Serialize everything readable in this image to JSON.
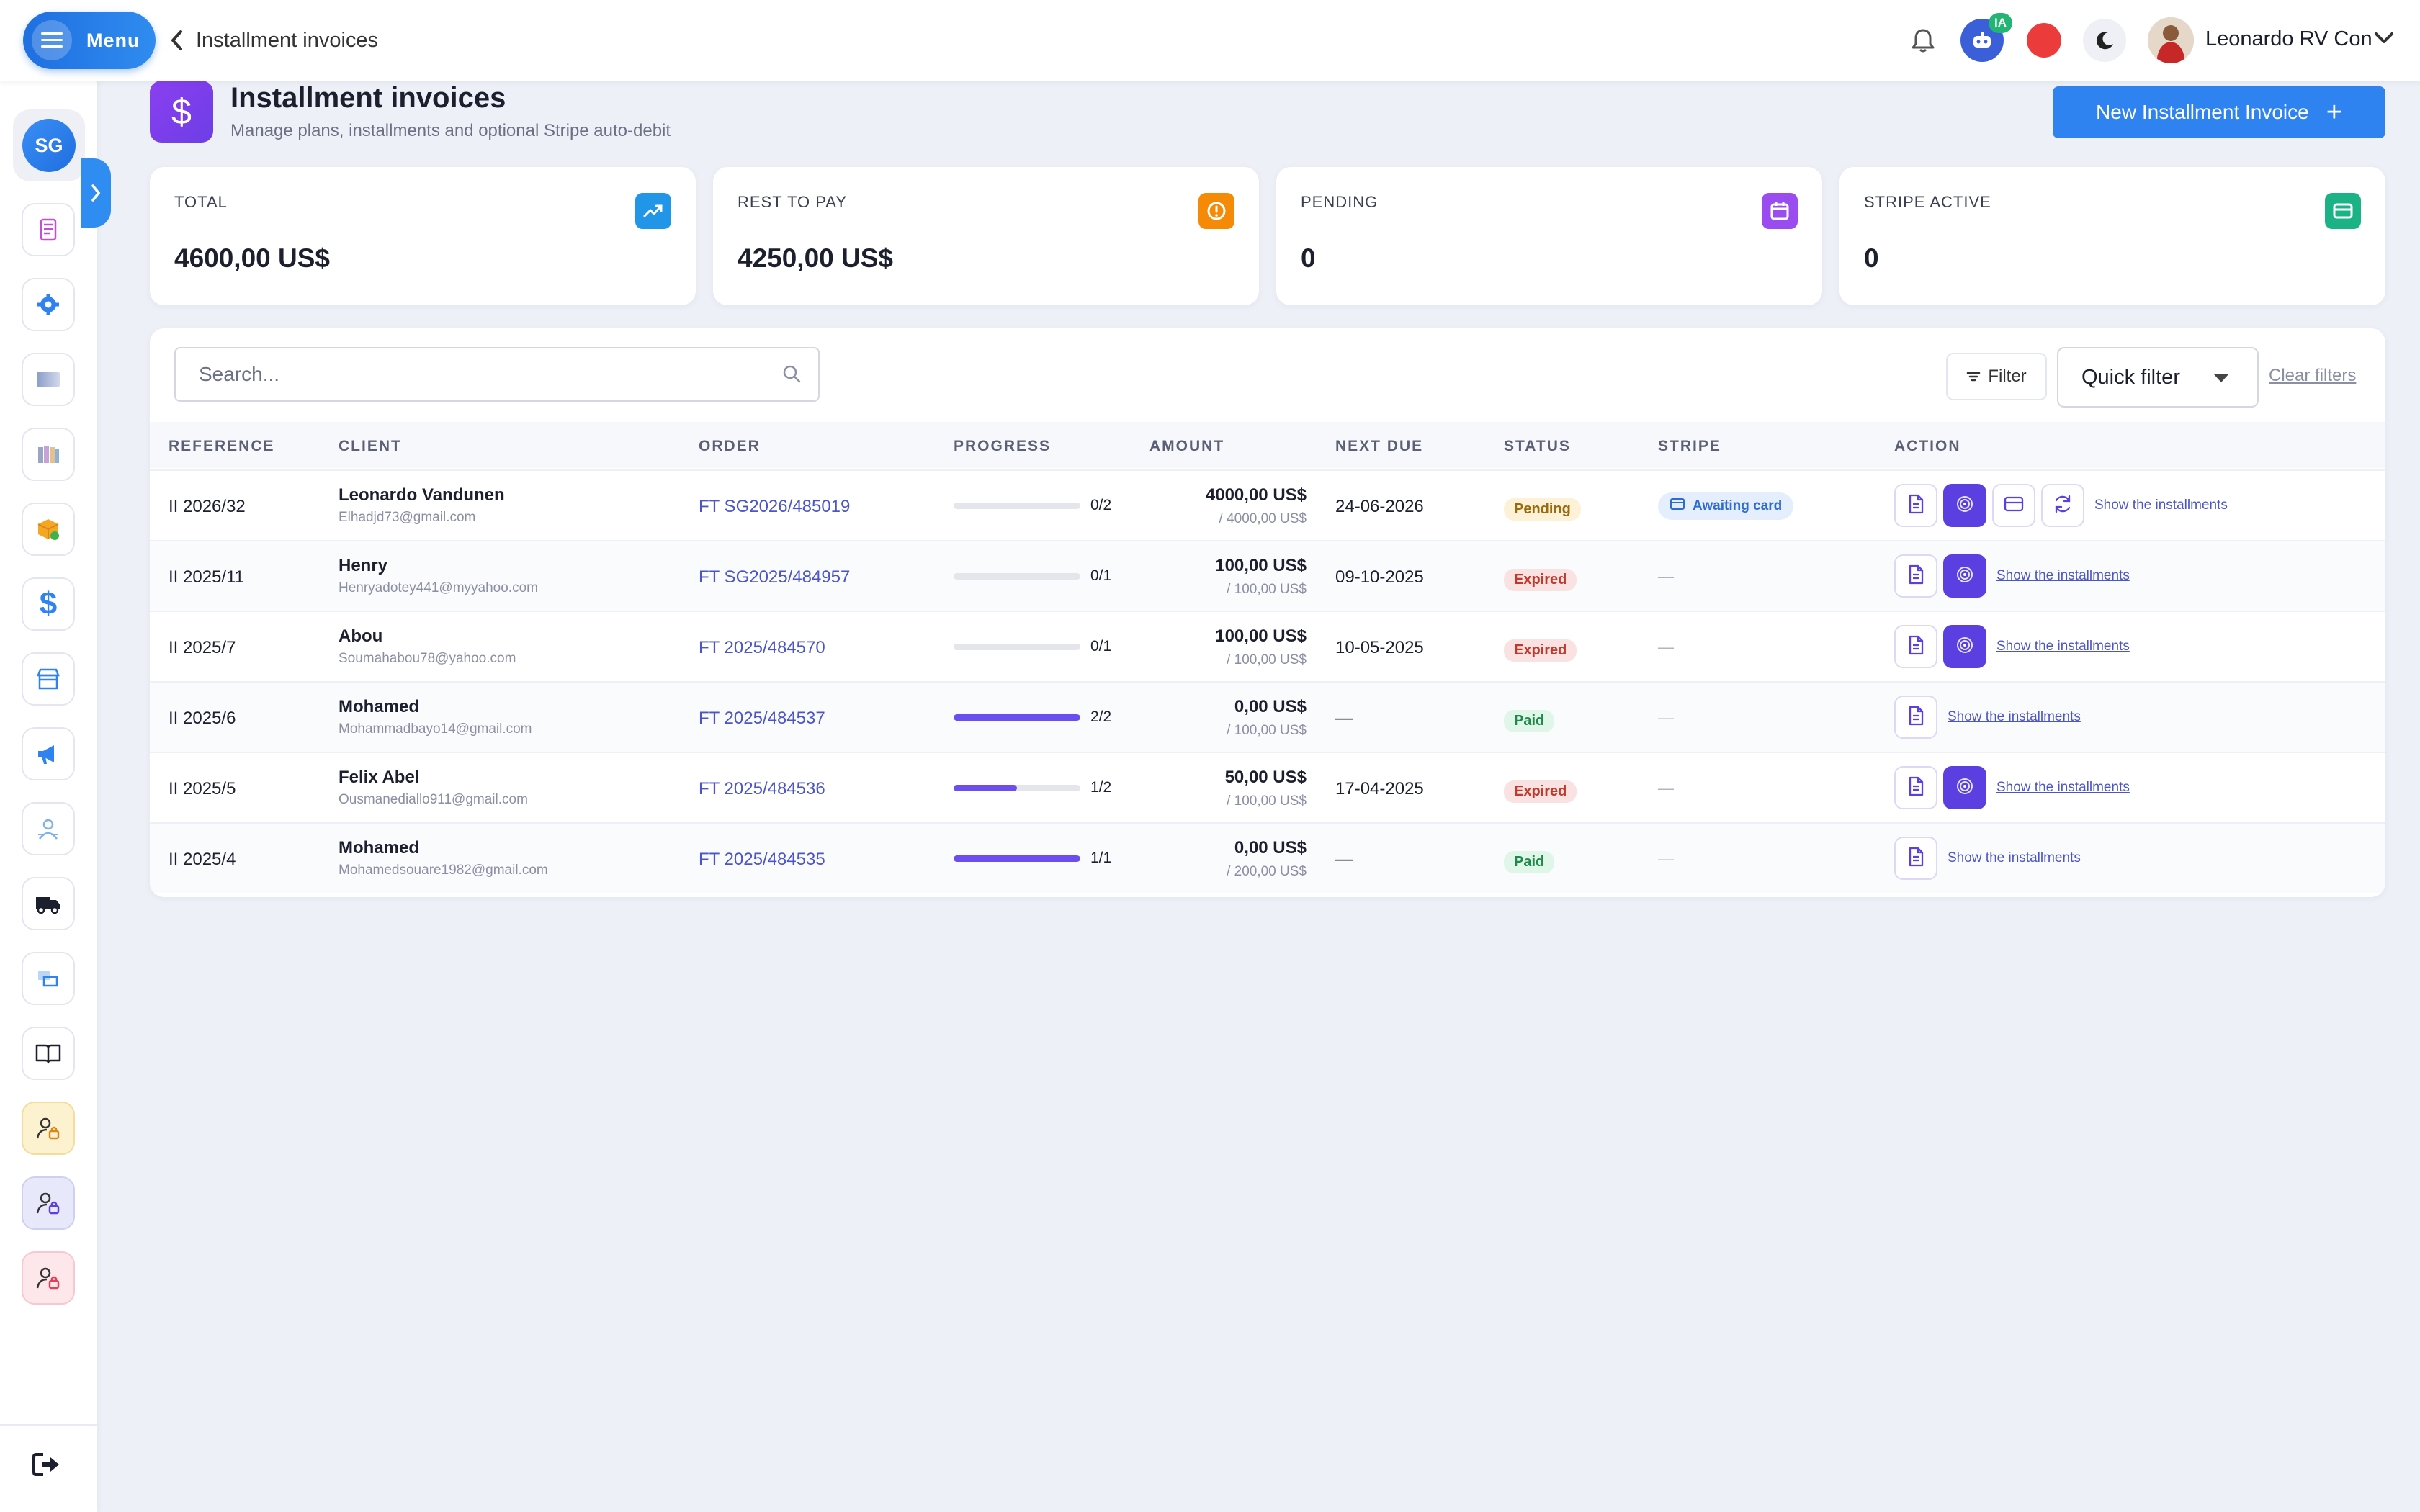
{
  "topbar": {
    "menu_label": "Menu",
    "back_label": "Installment invoices",
    "ia_badge": "IA",
    "user_name": "Leonardo RV Con"
  },
  "sidebar": {
    "avatar_initials": "SG"
  },
  "header": {
    "title": "Installment invoices",
    "subtitle": "Manage plans, installments and optional Stripe auto-debit",
    "new_button": "New Installment Invoice"
  },
  "stats": [
    {
      "label": "TOTAL",
      "value": "4600,00 US$",
      "icon": "trending-up-icon",
      "color": "#2196e8"
    },
    {
      "label": "REST TO PAY",
      "value": "4250,00 US$",
      "icon": "alert-circle-icon",
      "color": "#f58a07"
    },
    {
      "label": "PENDING",
      "value": "0",
      "icon": "calendar-icon",
      "color": "#9b4cf0"
    },
    {
      "label": "STRIPE ACTIVE",
      "value": "0",
      "icon": "credit-card-icon",
      "color": "#1bb386"
    }
  ],
  "toolbar": {
    "search_placeholder": "Search...",
    "filter_label": "Filter",
    "quick_filter": "Quick filter",
    "clear_filters": "Clear filters"
  },
  "table": {
    "columns": [
      "REFERENCE",
      "CLIENT",
      "ORDER",
      "PROGRESS",
      "AMOUNT",
      "NEXT DUE",
      "STATUS",
      "STRIPE",
      "ACTION"
    ],
    "rows": [
      {
        "ref": "II 2026/32",
        "name": "Leonardo Vandunen",
        "email": "Elhadjd73@gmail.com",
        "order": "FT SG2026/485019",
        "paid": 0,
        "total": 2,
        "progress": "0/2",
        "amount": "4000,00 US$",
        "amount_total": "/ 4000,00 US$",
        "due": "24-06-2026",
        "status": "Pending",
        "stripe": "Awaiting card",
        "link": "Show the installments"
      },
      {
        "ref": "II 2025/11",
        "name": "Henry",
        "email": "Henryadotey441@myyahoo.com",
        "order": "FT SG2025/484957",
        "paid": 0,
        "total": 1,
        "progress": "0/1",
        "amount": "100,00 US$",
        "amount_total": "/ 100,00 US$",
        "due": "09-10-2025",
        "status": "Expired",
        "stripe": "—",
        "link": "Show the installments"
      },
      {
        "ref": "II 2025/7",
        "name": "Abou",
        "email": "Soumahabou78@yahoo.com",
        "order": "FT 2025/484570",
        "paid": 0,
        "total": 1,
        "progress": "0/1",
        "amount": "100,00 US$",
        "amount_total": "/ 100,00 US$",
        "due": "10-05-2025",
        "status": "Expired",
        "stripe": "—",
        "link": "Show the installments"
      },
      {
        "ref": "II 2025/6",
        "name": "Mohamed",
        "email": "Mohammadbayo14@gmail.com",
        "order": "FT 2025/484537",
        "paid": 2,
        "total": 2,
        "progress": "2/2",
        "amount": "0,00 US$",
        "amount_total": "/ 100,00 US$",
        "due": "—",
        "status": "Paid",
        "stripe": "—",
        "link": "Show the installments"
      },
      {
        "ref": "II 2025/5",
        "name": "Felix Abel",
        "email": "Ousmanediallo911@gmail.com",
        "order": "FT 2025/484536",
        "paid": 1,
        "total": 2,
        "progress": "1/2",
        "amount": "50,00 US$",
        "amount_total": "/ 100,00 US$",
        "due": "17-04-2025",
        "status": "Expired",
        "stripe": "—",
        "link": "Show the installments"
      },
      {
        "ref": "II 2025/4",
        "name": "Mohamed",
        "email": "Mohamedsouare1982@gmail.com",
        "order": "FT 2025/484535",
        "paid": 1,
        "total": 1,
        "progress": "1/1",
        "amount": "0,00 US$",
        "amount_total": "/ 200,00 US$",
        "due": "—",
        "status": "Paid",
        "stripe": "—",
        "link": "Show the installments"
      }
    ]
  },
  "colors": {
    "accent": "#2e83f0",
    "purple": "#5b3fe0",
    "progress": "#6a4ef0"
  }
}
